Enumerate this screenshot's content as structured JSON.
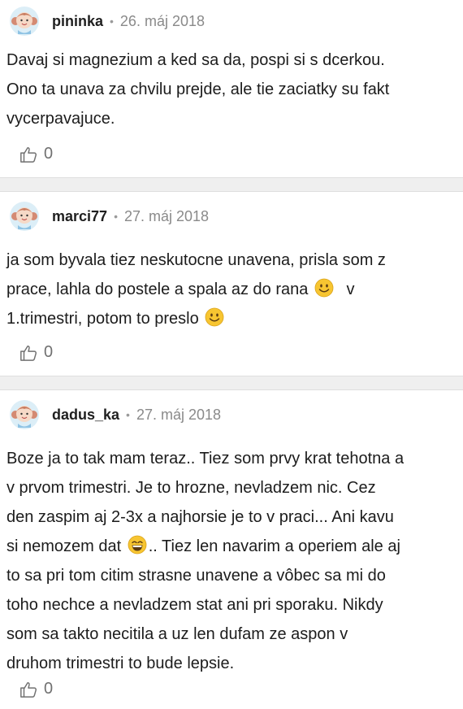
{
  "comments": [
    {
      "username": "pininka",
      "date": "26. máj 2018",
      "lines": [
        "Davaj si magnezium a ked sa da, pospi si s dcerkou.",
        "Ono ta unava za chvilu prejde, ale tie zaciatky su fakt",
        "vycerpavajuce."
      ],
      "likes": "0"
    },
    {
      "username": "marci77",
      "date": "27. máj 2018",
      "lines": [
        "ja som byvala tiez neskutocne unavena, prisla som z",
        "prace, lahla do postele a spala az do rana",
        "v",
        "1.trimestri, potom to preslo"
      ],
      "likes": "0"
    },
    {
      "username": "dadus_ka",
      "date": "27. máj 2018",
      "lines": [
        "Boze ja to tak mam teraz.. Tiez som prvy krat tehotna a",
        "v prvom trimestri. Je to hrozne, nevladzem nic. Cez",
        "den zaspim aj 2-3x a najhorsie je to v praci... Ani kavu",
        "si nemozem dat",
        ".. Tiez len navarim a operiem ale aj",
        "to sa pri tom citim strasne unavene a vôbec sa mi do",
        "toho nechce a nevladzem stat ani pri sporaku. Nikdy",
        "som sa takto necitila a uz len dufam ze aspon v",
        "druhom trimestri to bude lepsie."
      ],
      "likes": "0"
    }
  ],
  "separator_dot": "•",
  "icons": {
    "avatar": "girl-avatar-icon",
    "like": "thumbs-up-icon",
    "smile": "smile-emoji-icon",
    "grin": "grin-emoji-icon"
  },
  "colors": {
    "separator_band": "#efefef",
    "meta_text": "#8a8a8a",
    "emoji_yellow": "#f7c531"
  }
}
